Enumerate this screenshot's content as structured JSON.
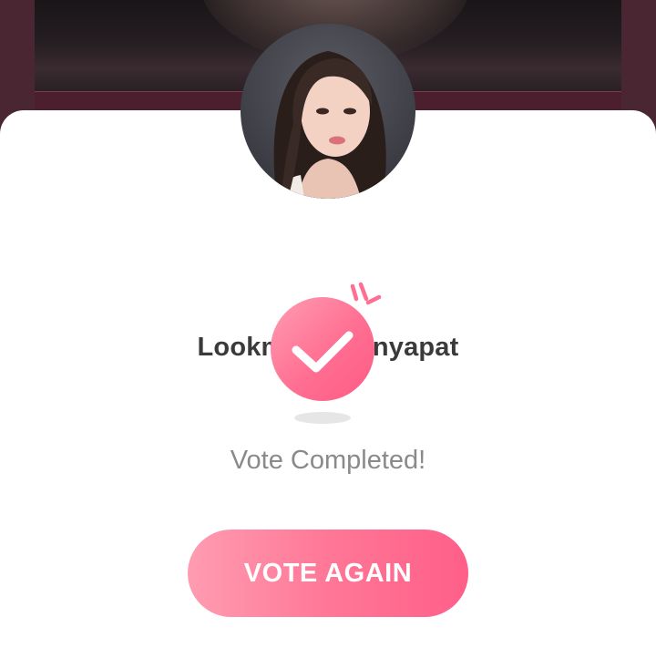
{
  "modal": {
    "name": "Lookmhee Punyapat",
    "status": "Vote Completed!",
    "vote_again_label": "VOTE AGAIN"
  },
  "icons": {
    "avatar": "profile-photo",
    "success": "check-circle-icon"
  },
  "colors": {
    "accent": "#ff6f92",
    "name_text": "#3a3a3a",
    "status_text": "#8a8a8a"
  }
}
